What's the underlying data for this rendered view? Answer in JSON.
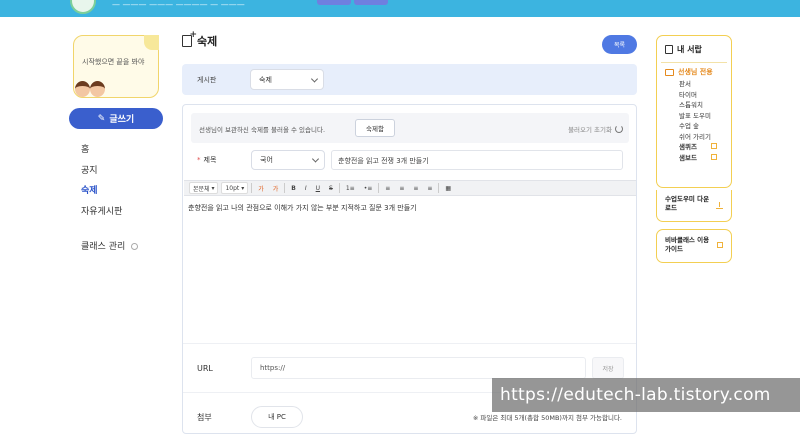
{
  "header": {
    "notice": "— ——— ——— ———— — ———",
    "accent": "#3cb4e0"
  },
  "sidebar": {
    "promo_text": "시작했으면 끝을 봐야",
    "write_button": "글쓰기",
    "items": [
      {
        "label": "홈"
      },
      {
        "label": "공지"
      },
      {
        "label": "숙제",
        "active": true
      },
      {
        "label": "자유게시판"
      },
      {
        "label": "클래스 관리"
      }
    ]
  },
  "page": {
    "title": "숙제",
    "list_button": "목록",
    "board_label": "게시판",
    "board_value": "숙제"
  },
  "form": {
    "info_message": "선생님이 보관하신 숙제를 불러올 수 있습니다.",
    "homework_button": "숙제함",
    "reset_label": "불러오기 초기화",
    "title_label": "제목",
    "subject_value": "국어",
    "title_value": "춘향전을 읽고 전쟁 3개 만들기",
    "toolbar": {
      "font_family": "본문체",
      "font_size": "10pt",
      "buttons": [
        "가",
        "가",
        "B",
        "I",
        "U",
        "S",
        "1≡",
        "•≡",
        "≡",
        "≡",
        "≡",
        "≡",
        "▦"
      ]
    },
    "body_text": "춘향전을 읽고 나의 관점으로 이해가 가지 않는 부분 지적하고 질문 3개 만들기",
    "url_label": "URL",
    "url_placeholder": "https://",
    "save_label": "저장",
    "attach_label": "첨부",
    "pc_button": "내 PC",
    "attach_note": "※ 파일은 최대 5개(총합 50MB)까지 첨부 가능합니다."
  },
  "right_panel": {
    "my_drawer": "내 서랍",
    "teacher_only": "선생님 전용",
    "links": [
      "판서",
      "타이머",
      "스톱워치",
      "발표 도우미",
      "수업 숲",
      "쉬어 가리기"
    ],
    "special_links": [
      "샘퀴즈",
      "샘보드"
    ],
    "guide_download": "수업도우미 다운로드",
    "usage_guide": "비바클래스 이용가이드",
    "border_color": "#f3cf52"
  },
  "watermark": "https://edutech-lab.tistory.com"
}
